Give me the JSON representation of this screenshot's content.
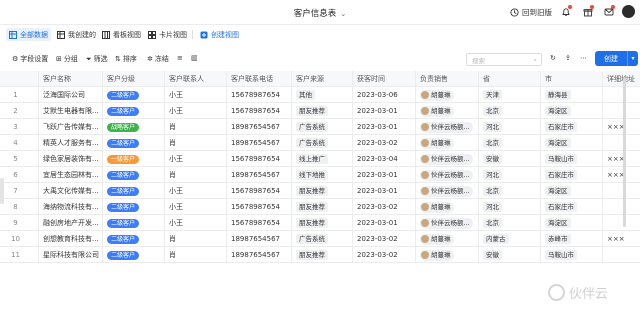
{
  "titlebar": {
    "title": "客户信息表",
    "back_label": "回到旧版"
  },
  "views": {
    "items": [
      "全部数据",
      "我创建的",
      "看板视图",
      "卡片视图"
    ],
    "create_label": "创建视图"
  },
  "toolbar": {
    "field_settings": "字段设置",
    "group": "分组",
    "filter": "筛选",
    "sort": "排序",
    "freeze": "冻结",
    "search_placeholder": "搜索",
    "create_label": "创建"
  },
  "colors": {
    "accent": "#1f6fe8",
    "tag_second": "#3b7ef6",
    "tag_strategic": "#3bb54a",
    "tag_first": "#f79a38"
  },
  "table": {
    "columns": [
      "客户名称",
      "客户分级",
      "客户联系人",
      "客户联系电话",
      "客户来源",
      "获客时间",
      "负责销售",
      "省",
      "市",
      "详细地址"
    ],
    "rows": [
      {
        "no": "1",
        "name": "泛海国际公司",
        "level": "二级客户",
        "contact": "小王",
        "phone": "15678987654",
        "source": "其他",
        "date": "2023-03-06",
        "sales": "胡蔓琳",
        "province": "天津",
        "city": "静海县",
        "address": ""
      },
      {
        "no": "2",
        "name": "艾默生电器有限...",
        "level": "二级客户",
        "contact": "小王",
        "phone": "15678987654",
        "source": "朋友推荐",
        "date": "2023-03-01",
        "sales": "胡蔓琳",
        "province": "北京",
        "city": "海淀区",
        "address": ""
      },
      {
        "no": "3",
        "name": "飞跃广告传媒有...",
        "level": "战略客户",
        "contact": "肖",
        "phone": "18987654567",
        "source": "广告系统",
        "date": "2023-03-01",
        "sales": "伙伴云杨额...",
        "province": "河北",
        "city": "石家庄市",
        "address": "×××"
      },
      {
        "no": "4",
        "name": "精英人才服务有...",
        "level": "二级客户",
        "contact": "肖",
        "phone": "18987654567",
        "source": "广告系统",
        "date": "2023-03-02",
        "sales": "胡蔓琳",
        "province": "北京",
        "city": "海淀区",
        "address": ""
      },
      {
        "no": "5",
        "name": "绿色家居装饰有...",
        "level": "一级客户",
        "contact": "小王",
        "phone": "15678987654",
        "source": "线上推广",
        "date": "2023-03-04",
        "sales": "伙伴云杨额...",
        "province": "安徽",
        "city": "马鞍山市",
        "address": "×××"
      },
      {
        "no": "6",
        "name": "宜居生态园林有...",
        "level": "二级客户",
        "contact": "肖",
        "phone": "18987654567",
        "source": "线下地推",
        "date": "2023-03-01",
        "sales": "伙伴云杨额...",
        "province": "河北",
        "city": "石家庄市",
        "address": "×××"
      },
      {
        "no": "7",
        "name": "大禹文化传媒有...",
        "level": "二级客户",
        "contact": "小王",
        "phone": "15678987654",
        "source": "朋友推荐",
        "date": "2023-03-01",
        "sales": "伙伴云杨额...",
        "province": "北京",
        "city": "海淀区",
        "address": ""
      },
      {
        "no": "8",
        "name": "海纳物流科技有...",
        "level": "二级客户",
        "contact": "小王",
        "phone": "15678987654",
        "source": "朋友推荐",
        "date": "2023-03-02",
        "sales": "胡蔓琳",
        "province": "河北",
        "city": "石家庄市",
        "address": ""
      },
      {
        "no": "9",
        "name": "融创房地产开发...",
        "level": "二级客户",
        "contact": "小王",
        "phone": "15678987654",
        "source": "朋友推荐",
        "date": "2023-03-01",
        "sales": "伙伴云杨额...",
        "province": "北京",
        "city": "海淀区",
        "address": ""
      },
      {
        "no": "10",
        "name": "创想教育科技有...",
        "level": "二级客户",
        "contact": "肖",
        "phone": "18987654567",
        "source": "广告系统",
        "date": "2023-03-02",
        "sales": "胡蔓琳",
        "province": "内蒙古",
        "city": "赤峰市",
        "address": "×××"
      },
      {
        "no": "11",
        "name": "星际科技有限公司",
        "level": "二级客户",
        "contact": "肖",
        "phone": "18987654567",
        "source": "朋友推荐",
        "date": "2023-03-02",
        "sales": "胡蔓琳",
        "province": "安徽",
        "city": "马鞍山市",
        "address": ""
      }
    ]
  },
  "watermark": "伙伴云"
}
